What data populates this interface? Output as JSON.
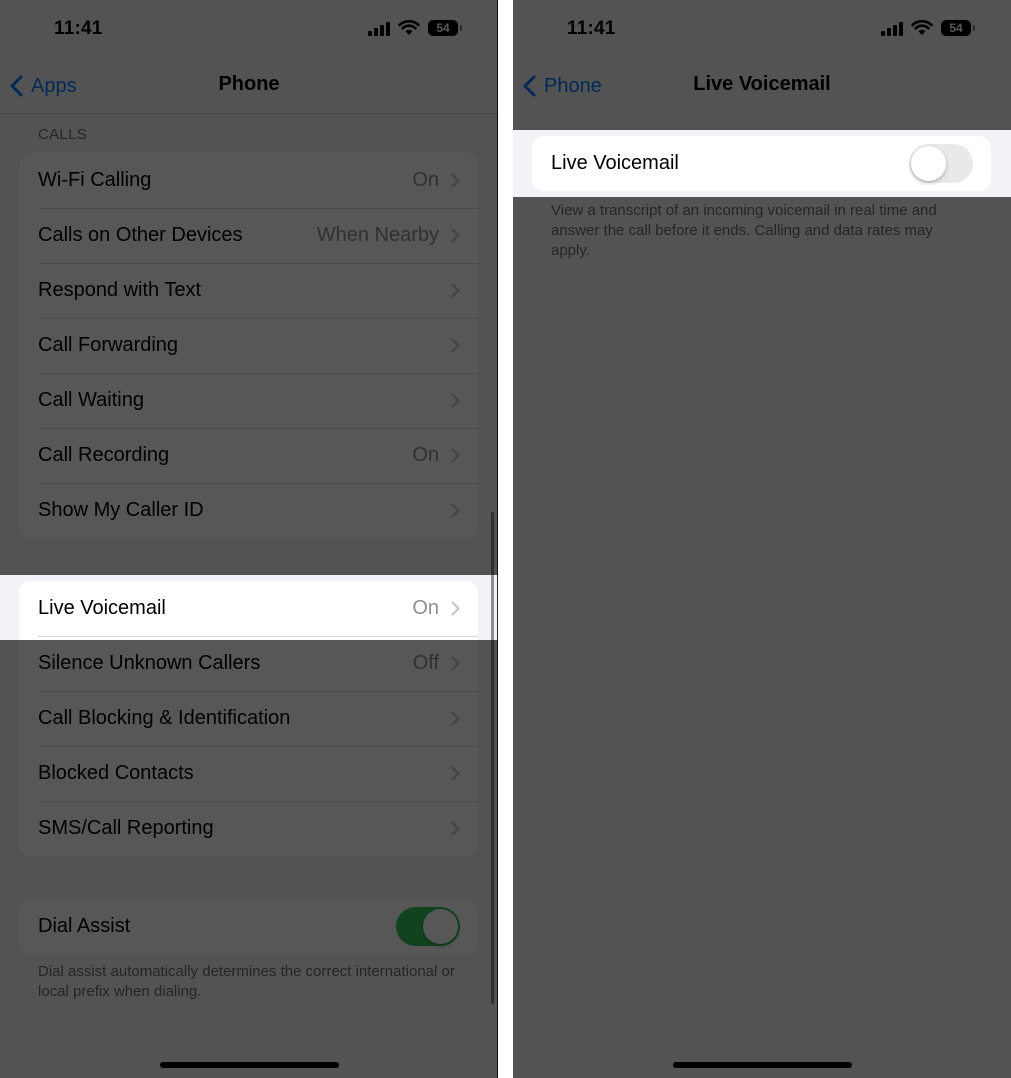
{
  "left_screen": {
    "status_bar": {
      "time": "11:41",
      "battery": "54"
    },
    "nav": {
      "back_label": "Apps",
      "title": "Phone"
    },
    "calls_section": {
      "header": "CALLS",
      "rows": [
        {
          "label": "Wi-Fi Calling",
          "value": "On"
        },
        {
          "label": "Calls on Other Devices",
          "value": "When Nearby"
        },
        {
          "label": "Respond with Text",
          "value": ""
        },
        {
          "label": "Call Forwarding",
          "value": ""
        },
        {
          "label": "Call Waiting",
          "value": ""
        },
        {
          "label": "Call Recording",
          "value": "On"
        },
        {
          "label": "Show My Caller ID",
          "value": ""
        }
      ]
    },
    "voicemail_section": {
      "rows": [
        {
          "label": "Live Voicemail",
          "value": "On"
        },
        {
          "label": "Silence Unknown Callers",
          "value": "Off"
        },
        {
          "label": "Call Blocking & Identification",
          "value": ""
        },
        {
          "label": "Blocked Contacts",
          "value": ""
        },
        {
          "label": "SMS/Call Reporting",
          "value": ""
        }
      ]
    },
    "dial_assist": {
      "label": "Dial Assist",
      "enabled": true,
      "footer": "Dial assist automatically determines the correct international or local prefix when dialing."
    }
  },
  "right_screen": {
    "status_bar": {
      "time": "11:41",
      "battery": "54"
    },
    "nav": {
      "back_label": "Phone",
      "title": "Live Voicemail"
    },
    "live_voicemail": {
      "label": "Live Voicemail",
      "enabled": false,
      "footer": "View a transcript of an incoming voicemail in real time and answer the call before it ends. Calling and data rates may apply."
    }
  },
  "colors": {
    "accent": "#007aff",
    "toggle_on": "#34c759",
    "background": "#f2f2f7",
    "dim_overlay": "rgba(0,0,0,0.66)"
  },
  "icons": [
    "cellular-signal-icon",
    "wifi-icon",
    "battery-icon",
    "chevron-left-icon",
    "chevron-right-icon"
  ]
}
